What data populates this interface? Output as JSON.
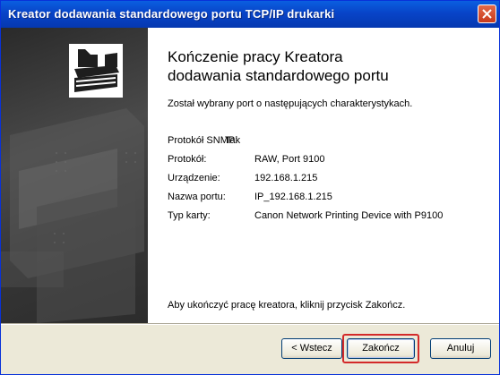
{
  "window": {
    "title": "Kreator dodawania standardowego portu TCP/IP drukarki"
  },
  "main": {
    "heading_line1": "Kończenie pracy Kreatora",
    "heading_line2": "dodawania standardowego portu",
    "intro": "Został wybrany port o następujących charakterystykach.",
    "details": [
      {
        "label": "Protokół SNMP:",
        "value": "Tak"
      },
      {
        "label": "Protokół:",
        "value": "RAW, Port 9100"
      },
      {
        "label": "Urządzenie:",
        "value": "192.168.1.215"
      },
      {
        "label": "Nazwa portu:",
        "value": "IP_192.168.1.215"
      },
      {
        "label": "Typ karty:",
        "value": "Canon Network Printing Device with P9100"
      }
    ],
    "finish_hint": "Aby ukończyć pracę kreatora, kliknij przycisk Zakończ."
  },
  "buttons": {
    "back": "< Wstecz",
    "finish": "Zakończ",
    "cancel": "Anuluj"
  },
  "icons": {
    "close": "close-icon",
    "wizard": "printer-wizard-icon"
  },
  "colors": {
    "title_bar": "#0844c8",
    "focus_highlight": "#d32a2a",
    "side_panel": "#3b3b3b"
  }
}
